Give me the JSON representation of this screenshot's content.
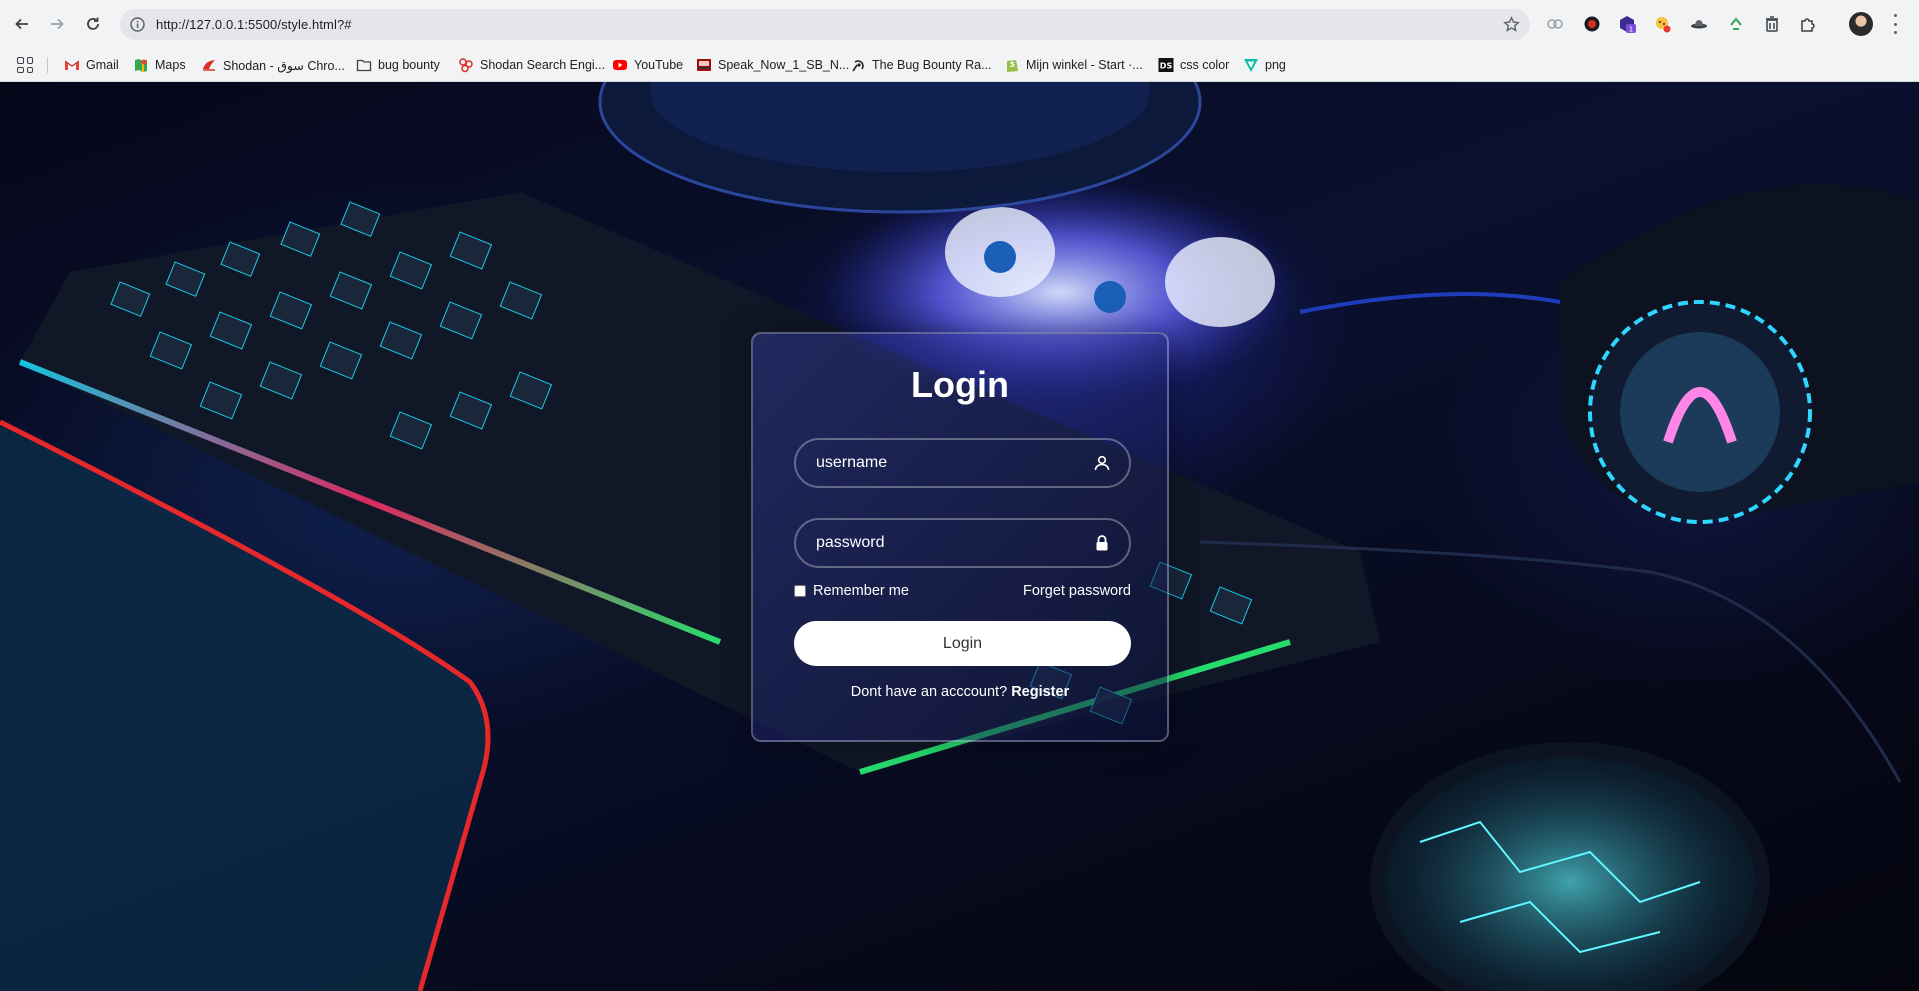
{
  "browser": {
    "url": "http://127.0.0.1:5500/style.html?#",
    "extension_badge": "1",
    "bookmarks": [
      {
        "label": "Gmail",
        "icon": "gmail-icon"
      },
      {
        "label": "Maps",
        "icon": "maps-icon"
      },
      {
        "label": "Shodan - سوق Chro...",
        "icon": "shodan-icon"
      },
      {
        "label": "bug bounty",
        "icon": "folder-icon"
      },
      {
        "label": "Shodan Search Engi...",
        "icon": "shodan-search-icon"
      },
      {
        "label": "YouTube",
        "icon": "youtube-icon"
      },
      {
        "label": "Speak_Now_1_SB_N...",
        "icon": "speak-now-icon"
      },
      {
        "label": "The Bug Bounty Ra...",
        "icon": "bug-bounty-icon"
      },
      {
        "label": "Mijn winkel - Start ·...",
        "icon": "shopify-icon"
      },
      {
        "label": "css color",
        "icon": "ds-icon"
      },
      {
        "label": "png",
        "icon": "png-icon"
      }
    ]
  },
  "login": {
    "title": "Login",
    "username_placeholder": "username",
    "password_placeholder": "password",
    "remember_label": "Remember me",
    "forgot_label": "Forget password",
    "button_label": "Login",
    "register_prompt": "Dont have an acccount?",
    "register_link": "Register"
  },
  "colors": {
    "card_border": "#ffffff",
    "button_bg": "#ffffff",
    "button_text": "#333333",
    "text": "#ffffff"
  }
}
